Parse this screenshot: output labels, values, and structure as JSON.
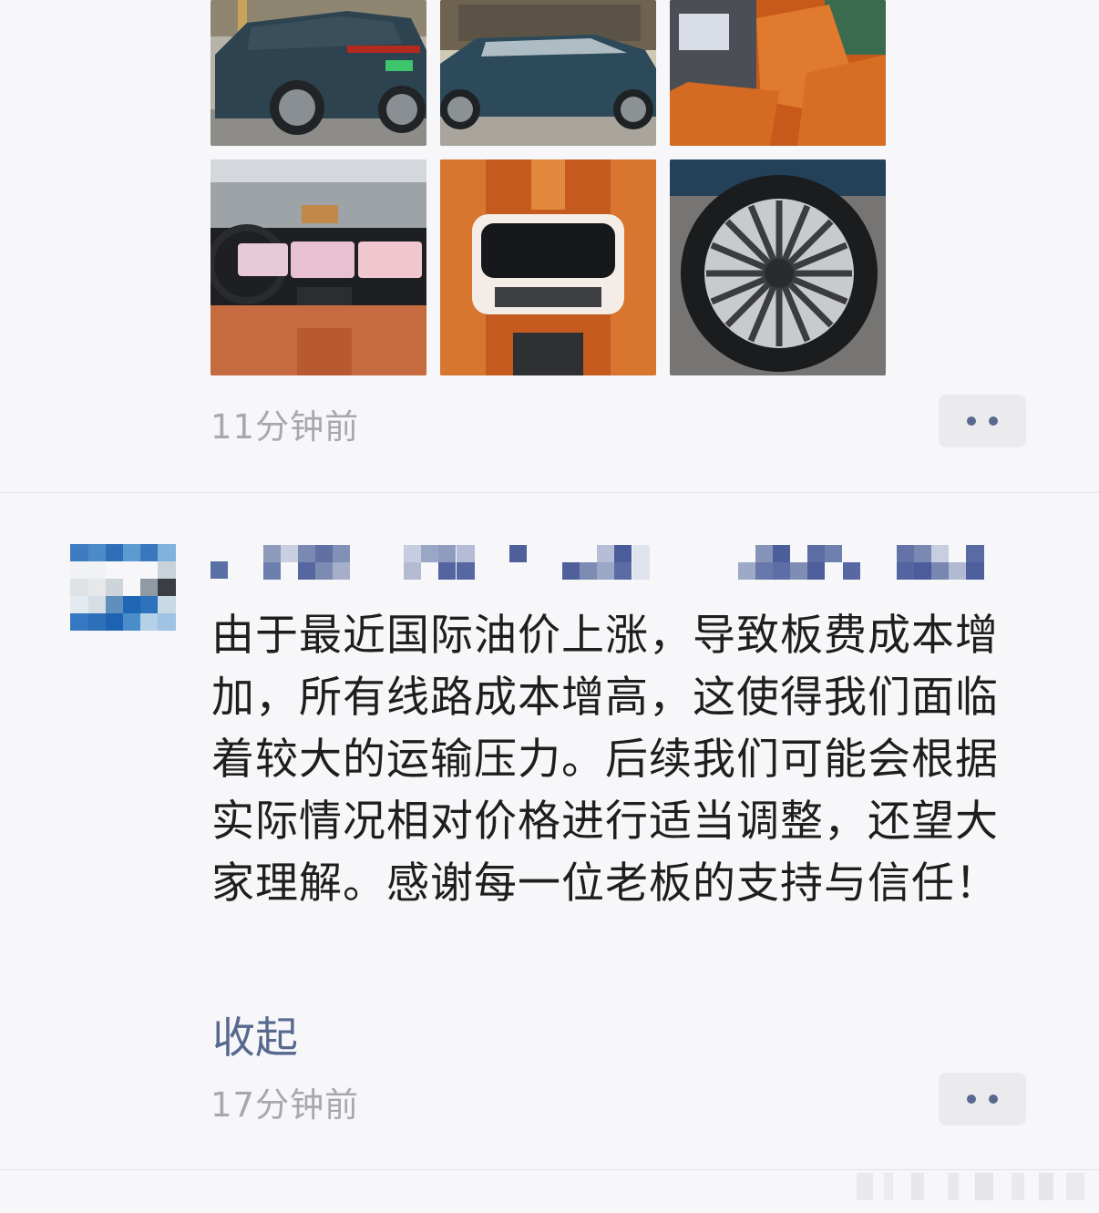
{
  "feed": {
    "previous_post": {
      "photos": [
        {
          "name": "photo-suv-rear",
          "kind": "exterior-rear"
        },
        {
          "name": "photo-suv-side",
          "kind": "exterior-side"
        },
        {
          "name": "photo-front-seats",
          "kind": "interior-seats"
        },
        {
          "name": "photo-dashboard",
          "kind": "interior-dashboard"
        },
        {
          "name": "photo-rear-console",
          "kind": "interior-rear-console"
        },
        {
          "name": "photo-wheel",
          "kind": "wheel"
        }
      ],
      "timestamp": "11分钟前",
      "more_icon": "more-dots-icon"
    },
    "post": {
      "avatar_icon": "pixelated-avatar",
      "author_name_icon": "pixelated-name",
      "text": "由于最近国际油价上涨，导致板费成本增加，所有线路成本增高，这使得我们面临着较大的运输压力。后续我们可能会根据实际情况相对价格进行适当调整，还望大家理解。感谢每一位老板的支持与信任！",
      "collapse_label": "收起",
      "timestamp": "17分钟前",
      "more_icon": "more-dots-icon"
    }
  },
  "colors": {
    "background": "#f7f7f9",
    "link": "#57698e",
    "muted_text": "#a7a7ad",
    "body_text": "#1e1e1e",
    "button_bg": "#ebebee"
  }
}
